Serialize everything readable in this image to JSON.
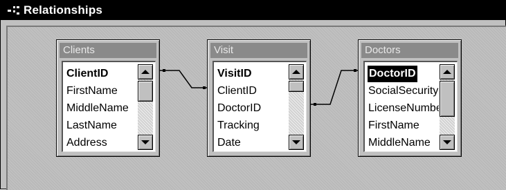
{
  "window": {
    "title": "Relationships",
    "icon": "relationships-icon"
  },
  "tables": [
    {
      "name": "Clients",
      "fields": [
        "ClientID",
        "FirstName",
        "MiddleName",
        "LastName",
        "Address"
      ],
      "primary_key": "ClientID"
    },
    {
      "name": "Visit",
      "fields": [
        "VisitID",
        "ClientID",
        "DoctorID",
        "Tracking",
        "Date"
      ],
      "primary_key": "VisitID"
    },
    {
      "name": "Doctors",
      "fields": [
        "DoctorID",
        "SocialSecurity",
        "LicenseNumbe",
        "FirstName",
        "MiddleName"
      ],
      "primary_key": "DoctorID",
      "selected_field": "DoctorID"
    }
  ],
  "relationships": [
    {
      "from": "Clients.ClientID",
      "to": "Visit.ClientID"
    },
    {
      "from": "Visit.DoctorID",
      "to": "Doctors.DoctorID"
    }
  ],
  "colors": {
    "titlebar": "#000000",
    "table_header": "#8a8a8a",
    "canvas": "#c0c0c0"
  }
}
